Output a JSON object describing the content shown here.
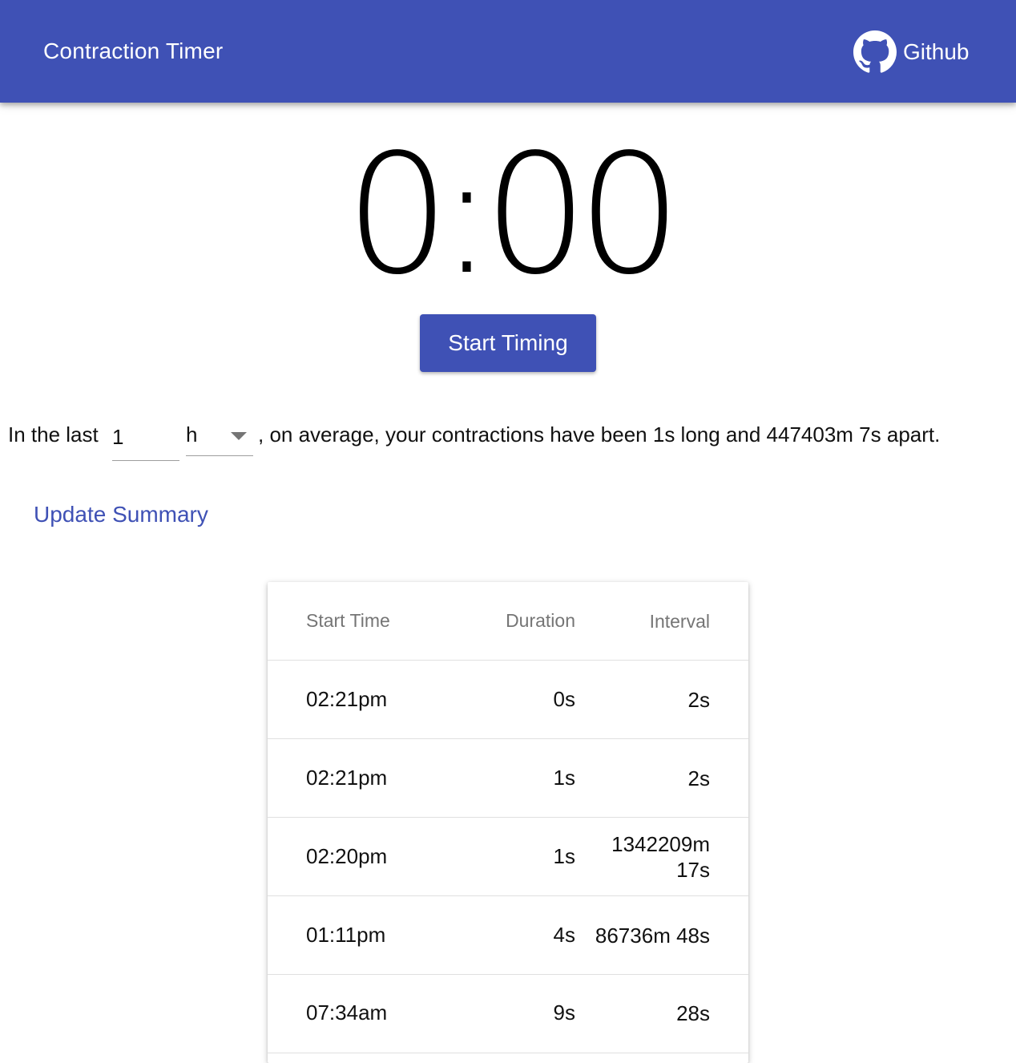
{
  "appbar": {
    "title": "Contraction Timer",
    "github_label": "Github",
    "github_icon": "github-icon",
    "color": "#3f51b5"
  },
  "timer": {
    "display": "0:00",
    "button_label": "Start Timing"
  },
  "summary": {
    "prefix": "In the last",
    "window_value": "1",
    "window_unit": "h",
    "suffix": ", on average, your contractions have been 1s long and 447403m 7s apart.",
    "update_label": "Update Summary"
  },
  "table": {
    "headers": [
      "Start Time",
      "Duration",
      "Interval"
    ],
    "rows": [
      {
        "start": "02:21pm",
        "duration": "0s",
        "interval": "2s"
      },
      {
        "start": "02:21pm",
        "duration": "1s",
        "interval": "2s"
      },
      {
        "start": "02:20pm",
        "duration": "1s",
        "interval": "1342209m 17s"
      },
      {
        "start": "01:11pm",
        "duration": "4s",
        "interval": "86736m 48s"
      },
      {
        "start": "07:34am",
        "duration": "9s",
        "interval": "28s"
      }
    ]
  }
}
